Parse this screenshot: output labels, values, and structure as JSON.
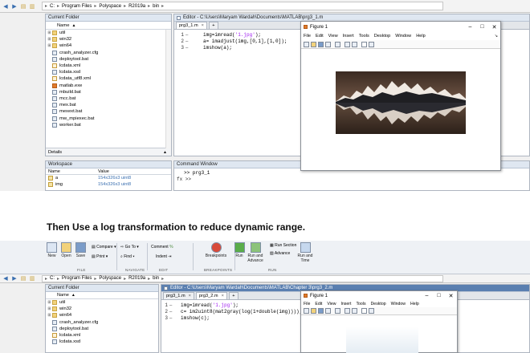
{
  "top": {
    "address": {
      "root": "C:",
      "path1": "Program Files",
      "path2": "Polyspace",
      "path3": "R2019a",
      "path4": "bin"
    },
    "current_folder_title": "Current Folder",
    "name_header": "Name",
    "files": [
      {
        "name": "util",
        "type": "folder"
      },
      {
        "name": "win32",
        "type": "folder"
      },
      {
        "name": "win64",
        "type": "folder"
      },
      {
        "name": "crash_analyzer.cfg",
        "type": "bat"
      },
      {
        "name": "deploytool.bat",
        "type": "bat"
      },
      {
        "name": "lcdata.xml",
        "type": "xml"
      },
      {
        "name": "lcdata.xsd",
        "type": "bat"
      },
      {
        "name": "lcdata_utf8.xml",
        "type": "xml"
      },
      {
        "name": "matlab.exe",
        "type": "matlab"
      },
      {
        "name": "mbuild.bat",
        "type": "bat"
      },
      {
        "name": "mcc.bat",
        "type": "bat"
      },
      {
        "name": "mex.bat",
        "type": "bat"
      },
      {
        "name": "mexext.bat",
        "type": "bat"
      },
      {
        "name": "mw_mpiexec.bat",
        "type": "bat"
      },
      {
        "name": "worker.bat",
        "type": "bat"
      }
    ],
    "details_label": "Details",
    "workspace_title": "Workspace",
    "ws_name_header": "Name",
    "ws_value_header": "Value",
    "ws_rows": [
      {
        "name": "a",
        "value": "154x326x3 uint8"
      },
      {
        "name": "img",
        "value": "154x326x3 uint8"
      }
    ],
    "editor_title": "Editor - C:\\Users\\Maryam Wardah\\Documents\\MATLAB\\prg3_1.m",
    "tab": "prg3_1.m",
    "code_lines": [
      {
        "n": "1",
        "text": "img=imread('1.jpg');"
      },
      {
        "n": "2",
        "text": "a= imadjust(img,[0,1],[1,0]);"
      },
      {
        "n": "3",
        "text": "imshow(a);"
      }
    ],
    "cmd_title": "Command Window",
    "cmd_line1": ">> prg3_1",
    "cmd_prompt": "fx >>",
    "figure": {
      "title": "Figure 1",
      "menu": [
        "File",
        "Edit",
        "View",
        "Insert",
        "Tools",
        "Desktop",
        "Window",
        "Help"
      ]
    }
  },
  "banner_text": "Then Use a log transformation to reduce dynamic range.",
  "bottom": {
    "ribbon": {
      "new": "New",
      "open": "Open",
      "save": "Save",
      "compare": "Compare",
      "goto": "Go To",
      "comment": "Comment",
      "print": "Print",
      "find": "Find",
      "indent": "Indent",
      "breakpoints": "Breakpoints",
      "run": "Run",
      "run_advance": "Run and\nAdvance",
      "run_section": "Run Section",
      "advance": "Advance",
      "run_time": "Run and\nTime",
      "sec_file": "FILE",
      "sec_nav": "NAVIGATE",
      "sec_edit": "EDIT",
      "sec_bp": "BREAKPOINTS",
      "sec_run": "RUN"
    },
    "address": {
      "root": "C:",
      "path1": "Program Files",
      "path2": "Polyspace",
      "path3": "R2019a",
      "path4": "bin"
    },
    "current_folder_title": "Current Folder",
    "name_header": "Name",
    "files": [
      {
        "name": "util",
        "type": "folder"
      },
      {
        "name": "win32",
        "type": "folder"
      },
      {
        "name": "win64",
        "type": "folder"
      },
      {
        "name": "crash_analyzer.cfg",
        "type": "bat"
      },
      {
        "name": "deploytool.bat",
        "type": "bat"
      },
      {
        "name": "lcdata.xml",
        "type": "xml"
      },
      {
        "name": "lcdata.xsd",
        "type": "bat"
      }
    ],
    "editor_title": "Editor - C:\\Users\\Maryam Wardah\\Documents\\MATLAB\\Chapter 3\\prg3_2.m",
    "tabs": [
      "prg3_1.m",
      "prg3_2.m"
    ],
    "code_lines": [
      {
        "n": "1",
        "text": "img=imread('1.jpg');"
      },
      {
        "n": "2",
        "text": "c= im2uint8(mat2gray(log(1+double(img))));"
      },
      {
        "n": "3",
        "text": "imshow(c);"
      }
    ],
    "figure": {
      "title": "Figure 1",
      "menu": [
        "File",
        "Edit",
        "View",
        "Insert",
        "Tools",
        "Desktop",
        "Window",
        "Help"
      ]
    }
  },
  "colors": {
    "accent": "#3a6fb0",
    "panel_header": "#dfe7f1",
    "string": "#a020f0"
  }
}
